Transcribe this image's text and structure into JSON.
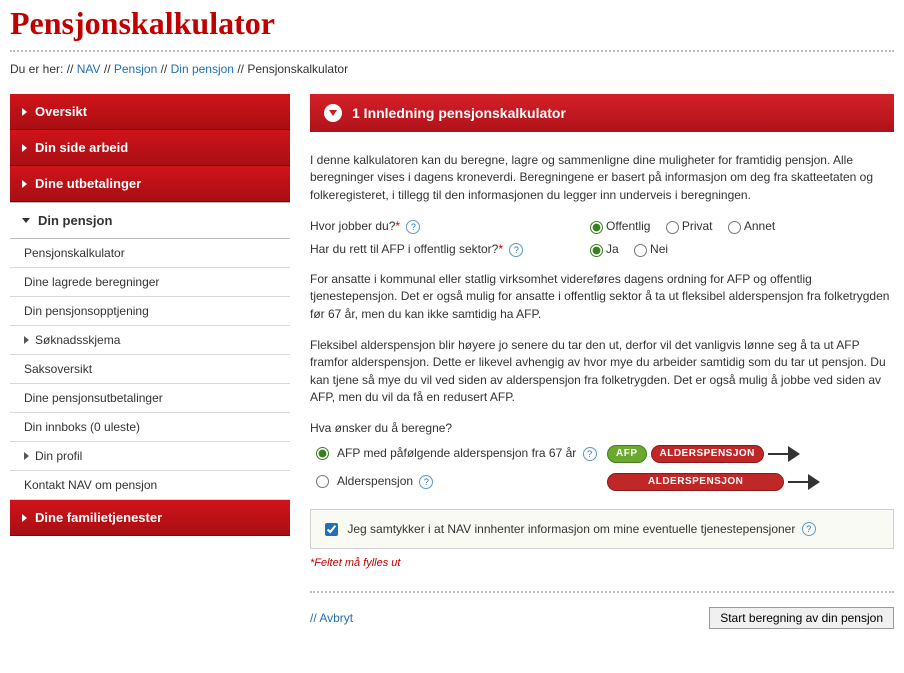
{
  "page_title": "Pensjonskalkulator",
  "breadcrumb": {
    "prefix": "Du er her:",
    "items": [
      "NAV",
      "Pensjon",
      "Din pensjon"
    ],
    "current": "Pensjonskalkulator"
  },
  "sidebar": {
    "sections": [
      {
        "label": "Oversikt"
      },
      {
        "label": "Din side arbeid"
      },
      {
        "label": "Dine utbetalinger"
      },
      {
        "label": "Din pensjon",
        "active": true
      },
      {
        "label": "Dine familietjenester"
      }
    ],
    "sub_items": [
      {
        "label": "Pensjonskalkulator"
      },
      {
        "label": "Dine lagrede beregninger"
      },
      {
        "label": "Din pensjonsopptjening"
      },
      {
        "label": "Søknadsskjema",
        "chevron": true
      },
      {
        "label": "Saksoversikt"
      },
      {
        "label": "Dine pensjonsutbetalinger"
      },
      {
        "label": "Din innboks (0 uleste)"
      },
      {
        "label": "Din profil",
        "chevron": true
      },
      {
        "label": "Kontakt NAV om pensjon"
      }
    ]
  },
  "main": {
    "step_title": "1 Innledning pensjonskalkulator",
    "intro": "I denne kalkulatoren kan du beregne, lagre og sammenligne dine muligheter for framtidig pensjon. Alle beregninger vises i dagens kroneverdi. Beregningene er basert på informasjon om deg fra skatteetaten og folkeregisteret, i tillegg til den informasjonen du legger inn underveis i beregningen.",
    "q1": {
      "label": "Hvor jobber du?",
      "options": [
        "Offentlig",
        "Privat",
        "Annet"
      ],
      "selected": 0
    },
    "q2": {
      "label": "Har du rett til AFP i offentlig sektor?",
      "options": [
        "Ja",
        "Nei"
      ],
      "selected": 0
    },
    "para1": "For ansatte i kommunal eller statlig virksomhet videreføres dagens ordning for AFP og offentlig tjenestepensjon. Det er også mulig for ansatte i offentlig sektor å ta ut fleksibel alderspensjon fra folketrygden før 67 år, men du kan ikke samtidig ha AFP.",
    "para2": "Fleksibel alderspensjon blir høyere jo senere du tar den ut, derfor vil det vanligvis lønne seg å ta ut AFP framfor alderspensjon. Dette er likevel avhengig av hvor mye du arbeider samtidig som du tar ut pensjon. Du kan tjene så mye du vil ved siden av alderspensjon fra folketrygden. Det er også mulig å jobbe ved siden av AFP, men du vil da få en redusert AFP.",
    "calc_question": "Hva ønsker du å beregne?",
    "calc_options": [
      {
        "label": "AFP med påfølgende alderspensjon fra 67 år",
        "pills": [
          "AFP",
          "ALDERSPENSJON"
        ],
        "selected": true
      },
      {
        "label": "Alderspensjon",
        "pills": [
          "ALDERSPENSJON"
        ],
        "selected": false
      }
    ],
    "consent": "Jeg samtykker i at NAV innhenter informasjon om mine eventuelle tjenestepensjoner",
    "footnote": "*Feltet må fylles ut",
    "cancel": "Avbryt",
    "start_button": "Start beregning av din pensjon"
  }
}
